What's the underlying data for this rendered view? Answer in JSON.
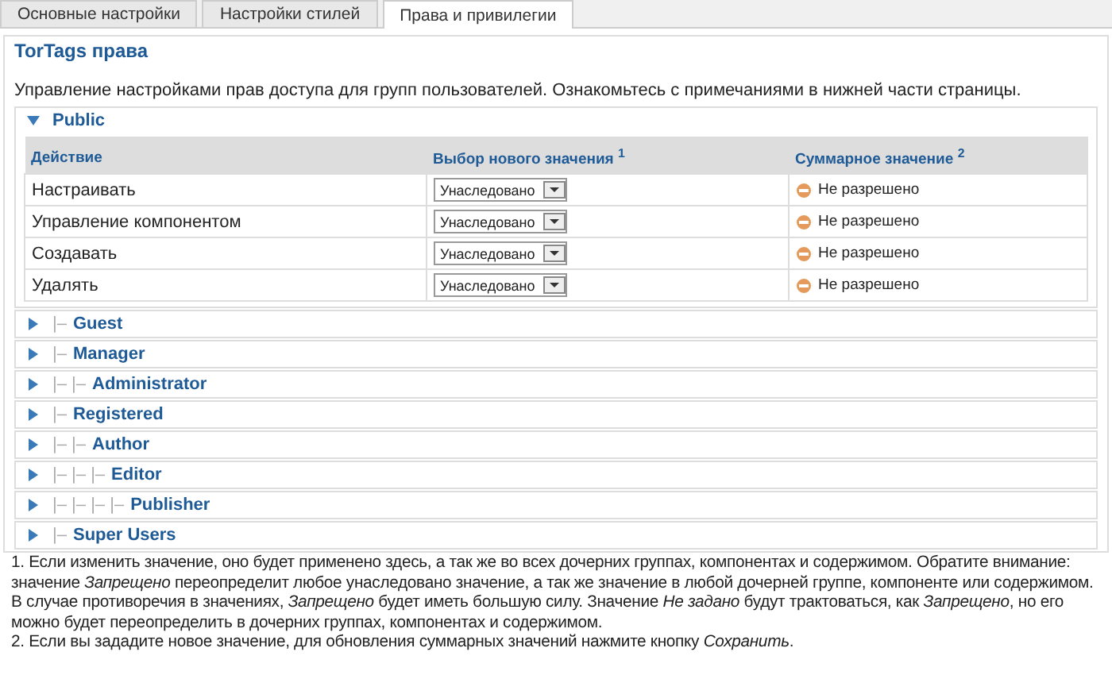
{
  "tabs": [
    {
      "label": "Основные настройки",
      "selected": false
    },
    {
      "label": "Настройки стилей",
      "selected": false
    },
    {
      "label": "Права и привилегии",
      "selected": true
    }
  ],
  "fieldset": {
    "legend": "TorTags права",
    "description": "Управление настройками прав доступа для групп пользователей. Ознакомьтесь с примечаниями в нижней части страницы."
  },
  "groups": [
    {
      "name": "Public",
      "expanded": true,
      "table": {
        "columns": [
          "Действие",
          "Выбор нового значения $^{1}$",
          "Суммарное значение $^{2}$"
        ],
        "rows": [
          {
            "action": "Настраивать",
            "select": "Унаследовано",
            "result": "Не разрешено"
          },
          {
            "action": "Управление компонентом",
            "select": "Унаследовано",
            "result": "Не разрешено"
          },
          {
            "action": "Создавать",
            "select": "Унаследовано",
            "result": "Не разрешено"
          },
          {
            "action": "Удалять",
            "select": "Унаследовано",
            "result": "Не разрешено"
          }
        ]
      }
    },
    {
      "prefix": "|–",
      "name": "Guest",
      "expanded": false
    },
    {
      "prefix": "|–",
      "name": "Manager",
      "expanded": false
    },
    {
      "prefix": "|– |–",
      "name": "Administrator",
      "expanded": false
    },
    {
      "prefix": "|–",
      "name": "Registered",
      "expanded": false
    },
    {
      "prefix": "|– |–",
      "name": "Author",
      "expanded": false
    },
    {
      "prefix": "|– |– |–",
      "name": "Editor",
      "expanded": false
    },
    {
      "prefix": "|– |– |– |–",
      "name": "Publisher",
      "expanded": false
    },
    {
      "prefix": "|–",
      "name": "Super Users",
      "expanded": false
    }
  ],
  "notes": [
    "1. Если изменить значение, оно будет применено здесь, а так же во всех дочерних группах, компонентах и содержимом. Обратите внимание: значение *Запрещено* переопределит любое унаследовано значение, а так же значение в любой дочерней группе, компоненте или содержимом. В случае противоречия в значениях, *Запрещено* будет иметь большую силу. Значение *Не задано* будут трактоваться, как *Запрещено*, но его можно будет переопределить в дочерних группах, компонентах и содержимом.",
    "2. Если вы зададите новое значение, для обновления суммарных значений нажмите кнопку *Сохранить*."
  ]
}
